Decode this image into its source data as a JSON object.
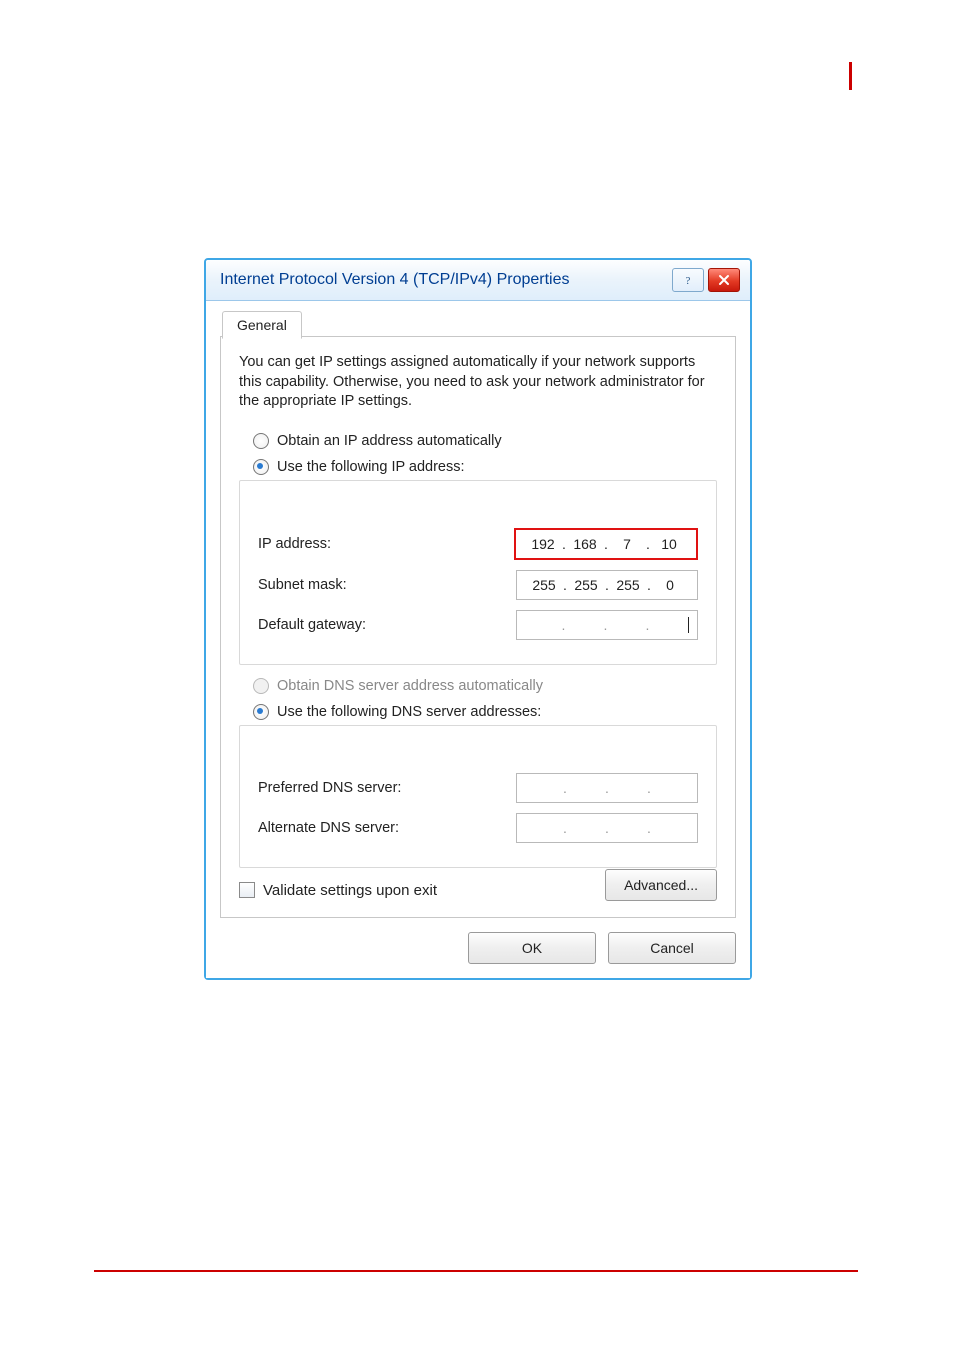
{
  "window": {
    "title": "Internet Protocol Version 4 (TCP/IPv4) Properties"
  },
  "tab": {
    "label": "General"
  },
  "intro": "You can get IP settings assigned automatically if your network supports this capability. Otherwise, you need to ask your network administrator for the appropriate IP settings.",
  "ipSection": {
    "autoLabel": "Obtain an IP address automatically",
    "manualLabel": "Use the following IP address:",
    "ipLabel": "IP address:",
    "ip": [
      "192",
      "168",
      "7",
      "10"
    ],
    "maskLabel": "Subnet mask:",
    "mask": [
      "255",
      "255",
      "255",
      "0"
    ],
    "gwLabel": "Default gateway:",
    "gw": [
      "",
      "",
      "",
      ""
    ]
  },
  "dnsSection": {
    "autoLabel": "Obtain DNS server address automatically",
    "manualLabel": "Use the following DNS server addresses:",
    "prefLabel": "Preferred DNS server:",
    "pref": [
      "",
      "",
      "",
      ""
    ],
    "altLabel": "Alternate DNS server:",
    "alt": [
      "",
      "",
      "",
      ""
    ]
  },
  "validateLabel": "Validate settings upon exit",
  "buttons": {
    "advanced": "Advanced...",
    "ok": "OK",
    "cancel": "Cancel"
  }
}
